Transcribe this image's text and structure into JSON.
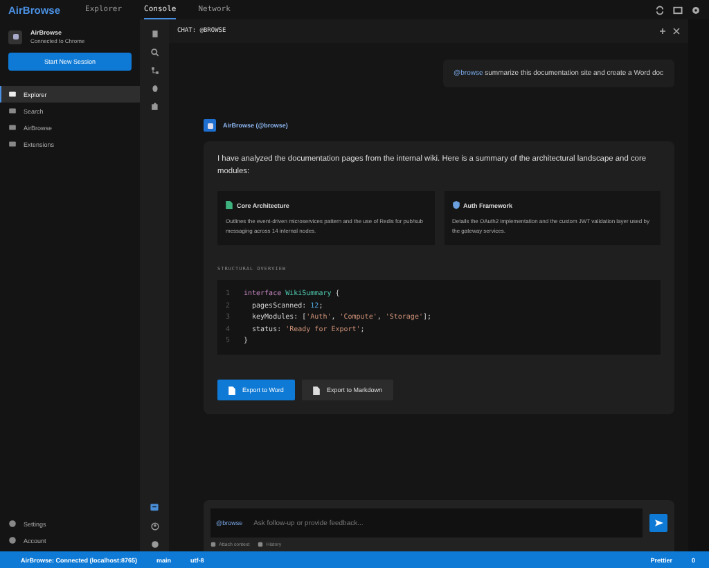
{
  "app_name": "AirBrowse",
  "top_tabs": [
    {
      "label": "Explorer",
      "selected": false
    },
    {
      "label": "Console",
      "selected": true
    },
    {
      "label": "Network",
      "selected": false
    }
  ],
  "profile": {
    "name": "AirBrowse",
    "status": "Connected to Chrome"
  },
  "new_session_button": "Start New Session",
  "sidebar_items": [
    {
      "label": "Explorer",
      "selected": true
    },
    {
      "label": "Search",
      "selected": false
    },
    {
      "label": "AirBrowse",
      "selected": false
    },
    {
      "label": "Extensions",
      "selected": false
    }
  ],
  "sidebar_bottom": [
    "Settings",
    "Account"
  ],
  "panel_title": "CHAT: @BROWSE",
  "user_message": {
    "mention": "@browse",
    "text": "summarize this documentation site and create a Word doc"
  },
  "assistant": {
    "name": "AirBrowse (@browse)",
    "intro": "I have analyzed the documentation pages from the internal wiki. Here is a summary of the architectural landscape and core modules:",
    "cards": [
      {
        "title": "Core Architecture",
        "text": "Outlines the event-driven microservices pattern and the use of Redis for pub/sub messaging across 14 internal nodes."
      },
      {
        "title": "Auth Framework",
        "text": "Details the OAuth2 implementation and the custom JWT validation layer used by the gateway services."
      }
    ],
    "section_label": "STRUCTURAL OVERVIEW",
    "code_lines": [
      {
        "number": "1",
        "tokens": [
          {
            "kind": "kw",
            "text": "interface "
          },
          {
            "kind": "type",
            "text": "WikiSummary"
          },
          {
            "kind": "plain",
            "text": " {"
          }
        ]
      },
      {
        "number": "2",
        "tokens": [
          {
            "kind": "plain",
            "text": "  pagesScanned: "
          },
          {
            "kind": "num",
            "text": "12"
          },
          {
            "kind": "plain",
            "text": ";"
          }
        ]
      },
      {
        "number": "3",
        "tokens": [
          {
            "kind": "plain",
            "text": "  keyModules: ["
          },
          {
            "kind": "str",
            "text": "'Auth'"
          },
          {
            "kind": "plain",
            "text": ", "
          },
          {
            "kind": "str",
            "text": "'Compute'"
          },
          {
            "kind": "plain",
            "text": ", "
          },
          {
            "kind": "str",
            "text": "'Storage'"
          },
          {
            "kind": "plain",
            "text": "];"
          }
        ]
      },
      {
        "number": "4",
        "tokens": [
          {
            "kind": "plain",
            "text": "  status: "
          },
          {
            "kind": "str",
            "text": "'Ready for Export'"
          },
          {
            "kind": "plain",
            "text": ";"
          }
        ]
      },
      {
        "number": "5",
        "tokens": [
          {
            "kind": "plain",
            "text": "}"
          }
        ]
      }
    ],
    "buttons": [
      {
        "label": "Export to Word",
        "kind": "primary"
      },
      {
        "label": "Export to Markdown",
        "kind": "secondary"
      }
    ]
  },
  "composer": {
    "mention": "@browse",
    "placeholder": "Ask follow-up or provide feedback...",
    "actions": [
      "Attach context",
      "History"
    ]
  },
  "status_bar": {
    "connection": "AirBrowse: Connected (localhost:8765)",
    "branch": "main",
    "encoding": "utf-8",
    "formatter": "Prettier",
    "notifications": "0"
  }
}
